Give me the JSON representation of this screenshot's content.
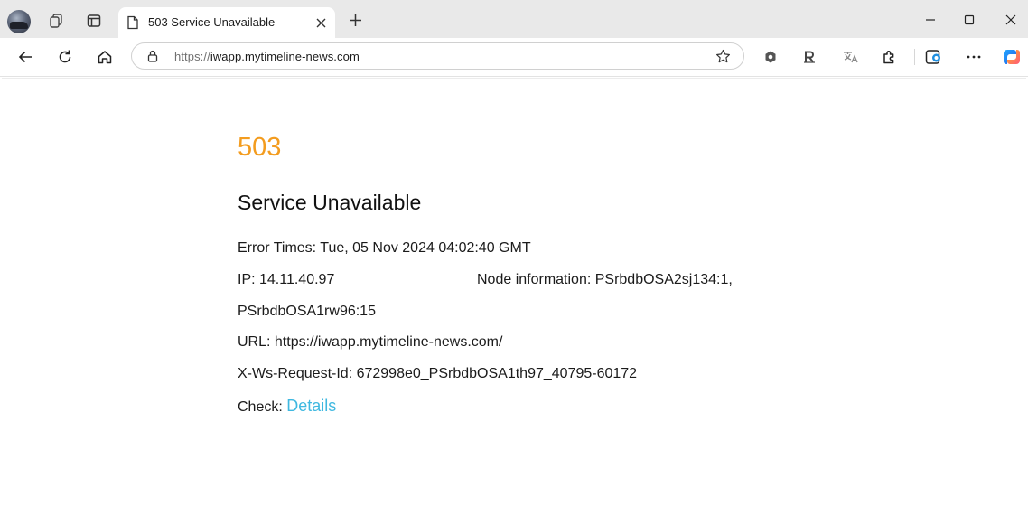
{
  "browser": {
    "tab": {
      "title": "503 Service Unavailable"
    },
    "address_bar": {
      "scheme": "https://",
      "host_path": "iwapp.mytimeline-news.com"
    },
    "icons": {
      "profile": "avatar",
      "workspaces": "workspaces-icon",
      "tab_actions": "tab-actions-icon",
      "page": "page-icon",
      "close_tab": "close-icon",
      "new_tab": "plus-icon",
      "minimize": "minimize-icon",
      "maximize": "maximize-icon",
      "close_window": "close-icon",
      "back": "back-arrow-icon",
      "refresh": "refresh-icon",
      "home": "home-icon",
      "lock": "lock-icon",
      "favorite": "star-icon",
      "extensions": "puzzle-icon",
      "more": "more-icon",
      "copilot": "copilot-icon"
    }
  },
  "page": {
    "code": "503",
    "title": "Service Unavailable",
    "error_times": "Error Times: Tue, 05 Nov 2024 04:02:40 GMT",
    "ip": "IP: 14.11.40.97",
    "node_info": "Node information: PSrbdbOSA2sj134:1,",
    "node_info_cont": "PSrbdbOSA1rw96:15",
    "url": "URL: https://iwapp.mytimeline-news.com/",
    "request_id": "X-Ws-Request-Id: 672998e0_PSrbdbOSA1th97_40795-60172",
    "check_label": "Check:",
    "details_link": "Details"
  },
  "colors": {
    "code": "#f39c1f",
    "link": "#3fb8e0",
    "tabstrip": "#e9e9e9"
  }
}
